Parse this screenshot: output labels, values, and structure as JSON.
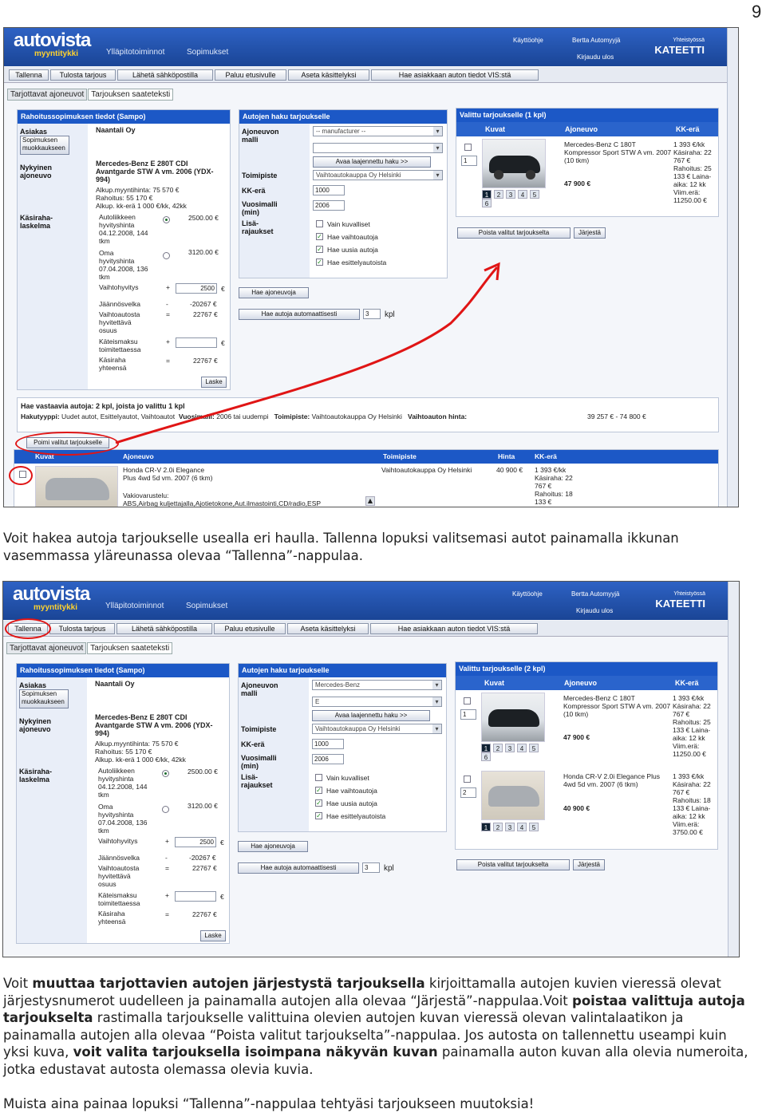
{
  "page_number": "9",
  "s1": {
    "logo": "autovista",
    "logo_sub": "myyntitykki",
    "nav": [
      "Ylläpitotoiminnot",
      "Sopimukset"
    ],
    "top_links": [
      "Käyttöohje",
      "Bertta Automyyjä",
      "Kirjaudu ulos"
    ],
    "brand_small": "Yhteistyössä",
    "brand": "KATEETTI",
    "toolbar": [
      "Tallenna",
      "Tulosta tarjous",
      "Lähetä sähköpostilla",
      "Paluu etusivulle",
      "Aseta käsittelyksi",
      "Hae asiakkaan auton tiedot VIS:stä"
    ],
    "tabs": [
      "Tarjottavat ajoneuvot",
      "Tarjouksen saateteksti"
    ],
    "left": {
      "title": "Rahoitussopimuksen tiedot (Sampo)",
      "asiakas_l": "Asiakas",
      "asiakas_v": "Naantali Oy",
      "sopimukset_btn": "Sopimuksen muokkaukseen",
      "nykyinen_l": "Nykyinen ajoneuvo",
      "vehicle": "Mercedes-Benz E 280T CDI Avantgarde STW A vm. 2006 (YDX-994)",
      "alkup": "Alkup.myyntihinta: 75 570 €",
      "rahoitus": "Rahoitus: 55 170 €",
      "alkup_kk": "Alkup. kk-erä 1 000 €/kk, 42kk",
      "kasiraha_l": "Käsiraha-laskelma",
      "aut_l": "Autoliikkeen hyvityshinta 04.12.2008, 144 tkm",
      "aut_v": "2500.00 €",
      "oma_l": "Oma hyvityshinta 07.04.2008, 136 tkm",
      "oma_v": "3120.00 €",
      "vaihto_l": "Vaihtohyvitys",
      "vaihto_s": "+",
      "vaihto_v": "2500",
      "jaannos_l": "Jäännösvelka",
      "jaannos_s": "-",
      "jaannos_v": "-20267 €",
      "vaihtoauto_l": "Vaihtoautosta hyvitettävä osuus",
      "vaihtoauto_s": "=",
      "vaihtoauto_v": "22767 €",
      "kateis_l": "Käteismaksu toimitettaessa",
      "kateis_s": "+",
      "kasiraha_y_l": "Käsiraha yhteensä",
      "kasiraha_y_s": "=",
      "kasiraha_y_v": "22767 €",
      "laske": "Laske",
      "euro": "€"
    },
    "mid": {
      "title": "Autojen haku tarjoukselle",
      "ajoneuvon_l": "Ajoneuvon malli",
      "malli": "-- manufacturer --",
      "laaj_btn": "Avaa laajennettu haku >>",
      "toimipiste_l": "Toimipiste",
      "toimipiste": "Vaihtoautokauppa Oy Helsinki",
      "kk_l": "KK-erä",
      "kk": "1000",
      "vuosi_l": "Vuosimalli (min)",
      "vuosi": "2006",
      "lisa_l": "Lisä-rajaukset",
      "checks": [
        "Vain kuvalliset",
        "Hae vaihtoautoja",
        "Hae uusia autoja",
        "Hae esittelyautoista"
      ],
      "hae_btn": "Hae ajoneuvoja",
      "auto_btn": "Hae autoja automaattisesti",
      "count": "3",
      "kpl": "kpl"
    },
    "right": {
      "title": "Valittu tarjoukselle (1 kpl)",
      "cols": [
        "Kuvat",
        "Ajoneuvo",
        "KK-erä"
      ],
      "order": "1",
      "pages": [
        "1",
        "2",
        "3",
        "4",
        "5",
        "6"
      ],
      "car": "Mercedes-Benz C 180T Kompressor Sport STW A vm. 2007 (10 tkm)",
      "price": "47 900 €",
      "kk": "1 393 €/kk Käsiraha: 22 767 € Rahoitus: 25 133 € Laina-aika: 12 kk Viim.erä: 11250.00 €",
      "poista": "Poista valitut tarjoukselta",
      "jarjesta": "Järjestä"
    },
    "summary": {
      "line1": "Hae vastaavia autoja: 2 kpl, joista jo valittu 1 kpl",
      "l2_1": "Hakutyyppi:",
      "v2_1": "Uudet autot, Esittelyautot, Vaihtoautot",
      "l2_2": "Vuosimalli:",
      "v2_2": "2006 tai uudempi",
      "l2_3": "Toimipiste:",
      "v2_3": "Vaihtoautokauppa Oy Helsinki",
      "l2_4": "Vaihtoauton hinta:",
      "v2_4": "39 257 € - 74 800 €"
    },
    "poimi": "Poimi valitut tarjoukselle",
    "res": {
      "cols": [
        "Kuvat",
        "Ajoneuvo",
        "Toimipiste",
        "Hinta",
        "KK-erä"
      ],
      "car": "Honda CR-V 2.0i Elegance Plus 4wd 5d vm. 2007 (6 tkm)",
      "vakio": "Vakiovarustelu:",
      "vakio2": "ABS,Airbag kuljettajalla,Ajotietokone,Aut.ilmastointi,CD/radio,ESP",
      "toimi": "Vaihtoautokauppa Oy Helsinki",
      "hinta": "40 900 €",
      "kk": "1 393 €/kk Käsiraha: 22 767 € Rahoitus: 18 133 €"
    }
  },
  "text1": "Voit hakea autoja tarjoukselle usealla eri haulla. Tallenna lopuksi valitsemasi autot painamalla ikkunan vasemmassa yläreunassa olevaa “Tallenna”-nappulaa.",
  "s2": {
    "right": {
      "title": "Valittu tarjoukselle (2 kpl)",
      "cols": [
        "Kuvat",
        "Ajoneuvo",
        "KK-erä"
      ],
      "car1": "Mercedes-Benz C 180T Kompressor Sport STW A vm. 2007 (10 tkm)",
      "price1": "47 900 €",
      "kk1": "1 393 €/kk Käsiraha: 22 767 € Rahoitus: 25 133 € Laina-aika: 12 kk Viim.erä: 11250.00 €",
      "car2": "Honda CR-V 2.0i Elegance Plus 4wd 5d vm. 2007 (6 tkm)",
      "price2": "40 900 €",
      "kk2": "1 393 €/kk Käsiraha: 22 767 € Rahoitus: 18 133 € Laina-aika: 12 kk Viim.erä: 3750.00 €",
      "order1": "1",
      "order2": "2"
    },
    "mid": {
      "malli": "Mercedes-Benz",
      "malli2": "E"
    }
  },
  "text2": {
    "p1a": "Voit ",
    "p1b": "muuttaa tarjottavien autojen järjestystä tarjouksella",
    "p1c": " kirjoittamalla autojen kuvien vieressä olevat järjestysnumerot uudelleen ja painamalla autojen alla olevaa “Järjestä”-nappulaa.Voit ",
    "p1d": "poistaa valittuja autoja tarjoukselta",
    "p1e": " rastimalla tarjoukselle valittuina olevien autojen kuvan vieressä olevan valintalaatikon ja painamalla autojen alla olevaa “Poista valitut tarjoukselta”-nappulaa. Jos autosta on tallennettu useampi kuin yksi kuva, ",
    "p1f": "voit valita tarjouksella isoimpana näkyvän kuvan",
    "p1g": " painamalla auton kuvan alla olevia numeroita, jotka edustavat autosta olemassa olevia kuvia.",
    "p2": "Muista aina painaa lopuksi “Tallenna”-nappulaa tehtyäsi tarjoukseen muutoksia!"
  }
}
